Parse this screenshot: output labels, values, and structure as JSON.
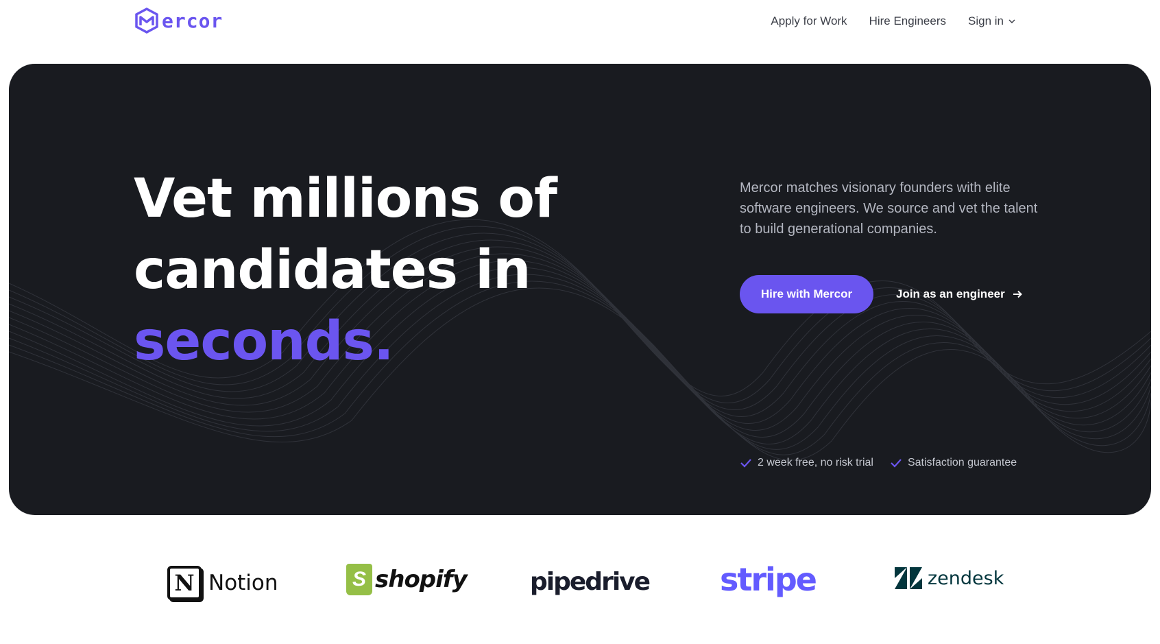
{
  "brand": {
    "name": "Mercor",
    "logo_icon": "mercor-hexagon-logo",
    "accent_color": "#6a55ef"
  },
  "nav": {
    "apply": "Apply for Work",
    "hire": "Hire Engineers",
    "signin": "Sign in"
  },
  "hero": {
    "headline_line1": "Vet millions of",
    "headline_line2": "candidates in",
    "headline_accent": "seconds.",
    "description": "Mercor matches visionary founders with elite software engineers. We source and vet the talent to build generational companies.",
    "primary_cta": "Hire with Mercor",
    "secondary_cta": "Join as an engineer",
    "perks": [
      "2 week free, no risk trial",
      "Satisfaction guarantee"
    ],
    "background_color": "#191b20"
  },
  "customers": {
    "logos": [
      {
        "name": "Notion",
        "icon": "notion-logo"
      },
      {
        "name": "shopify",
        "icon": "shopify-logo",
        "color": "#95bf47"
      },
      {
        "name": "pipedrive",
        "icon": "pipedrive-logo"
      },
      {
        "name": "stripe",
        "icon": "stripe-logo",
        "color": "#635bff"
      },
      {
        "name": "zendesk",
        "icon": "zendesk-logo",
        "color": "#03363d"
      }
    ]
  }
}
